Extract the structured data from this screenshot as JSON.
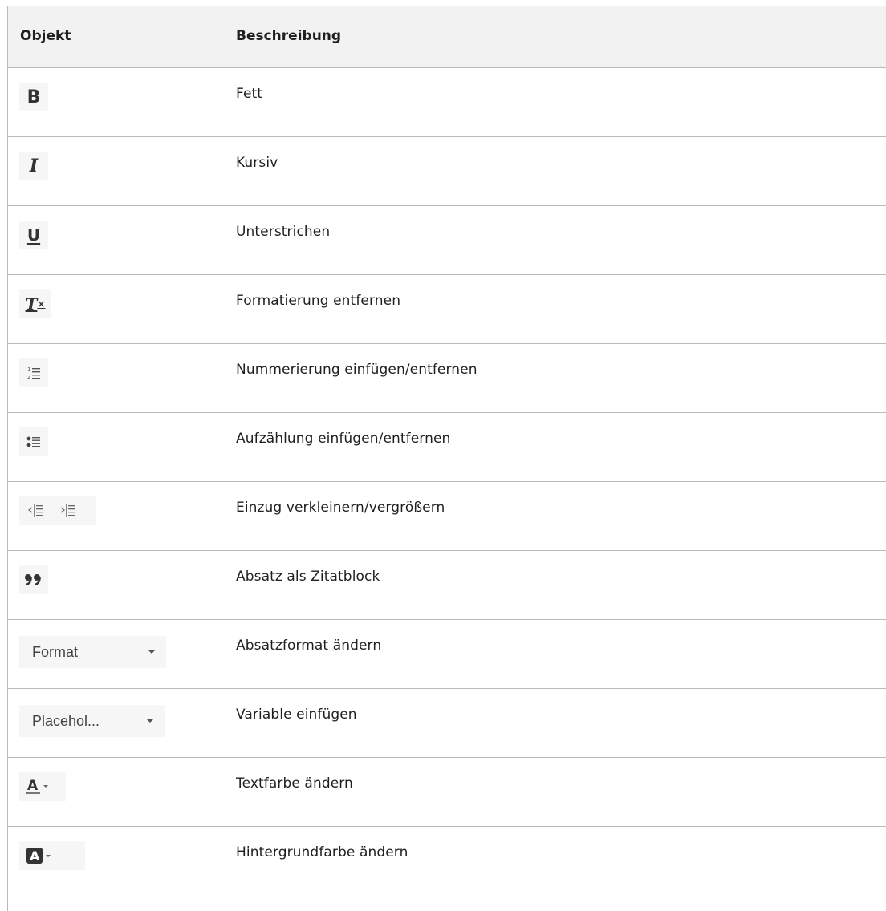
{
  "table": {
    "headers": {
      "object": "Objekt",
      "description": "Beschreibung"
    },
    "rows": [
      {
        "icon": "bold-icon",
        "icon_text": "B",
        "description": "Fett"
      },
      {
        "icon": "italic-icon",
        "icon_text": "I",
        "description": "Kursiv"
      },
      {
        "icon": "underline-icon",
        "icon_text": "U",
        "description": "Unterstrichen"
      },
      {
        "icon": "remove-format-icon",
        "icon_text": "T",
        "icon_sub": "×",
        "description": "Formatierung entfernen"
      },
      {
        "icon": "numbered-list-icon",
        "description": "Nummerierung einfügen/entfernen"
      },
      {
        "icon": "bulleted-list-icon",
        "description": "Aufzählung einfügen/entfernen"
      },
      {
        "icon": "outdent-indent-icon",
        "description": "Einzug verkleinern/vergrößern"
      },
      {
        "icon": "blockquote-icon",
        "description": "Absatz als Zitatblock"
      },
      {
        "icon": "format-dropdown",
        "dropdown_label": "Format",
        "description": "Absatzformat ändern"
      },
      {
        "icon": "placeholder-dropdown",
        "dropdown_label": "Placehol...",
        "description": "Variable einfügen"
      },
      {
        "icon": "text-color-icon",
        "icon_text": "A",
        "description": "Textfarbe ändern"
      },
      {
        "icon": "background-color-icon",
        "icon_text": "A",
        "description": "Hintergrundfarbe ändern"
      }
    ]
  }
}
